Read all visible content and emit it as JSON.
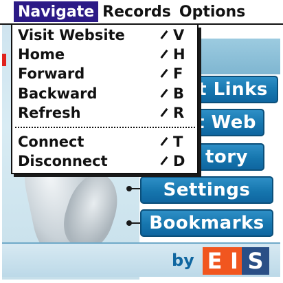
{
  "menubar": {
    "items": [
      {
        "label": "Navigate",
        "active": true
      },
      {
        "label": "Records",
        "active": false
      },
      {
        "label": "Options",
        "active": false
      }
    ]
  },
  "dropdown": {
    "group1": [
      {
        "label": "Visit Website",
        "shortcut": "V"
      },
      {
        "label": "Home",
        "shortcut": "H"
      },
      {
        "label": "Forward",
        "shortcut": "F"
      },
      {
        "label": "Backward",
        "shortcut": "B"
      },
      {
        "label": "Refresh",
        "shortcut": "R"
      }
    ],
    "group2": [
      {
        "label": "Connect",
        "shortcut": "T"
      },
      {
        "label": "Disconnect",
        "shortcut": "D"
      }
    ]
  },
  "app": {
    "buttons": [
      {
        "label": "t Links"
      },
      {
        "label": "t Web"
      },
      {
        "label": "tory"
      },
      {
        "label": "Settings"
      },
      {
        "label": "Bookmarks"
      }
    ],
    "footer": {
      "by": "by",
      "logo": [
        "E",
        "I",
        "S"
      ]
    }
  },
  "colors": {
    "menu_highlight": "#2c1a86",
    "button_blue": "#1676ae",
    "logo_orange": "#f1561f",
    "logo_navy": "#2a4f86"
  }
}
